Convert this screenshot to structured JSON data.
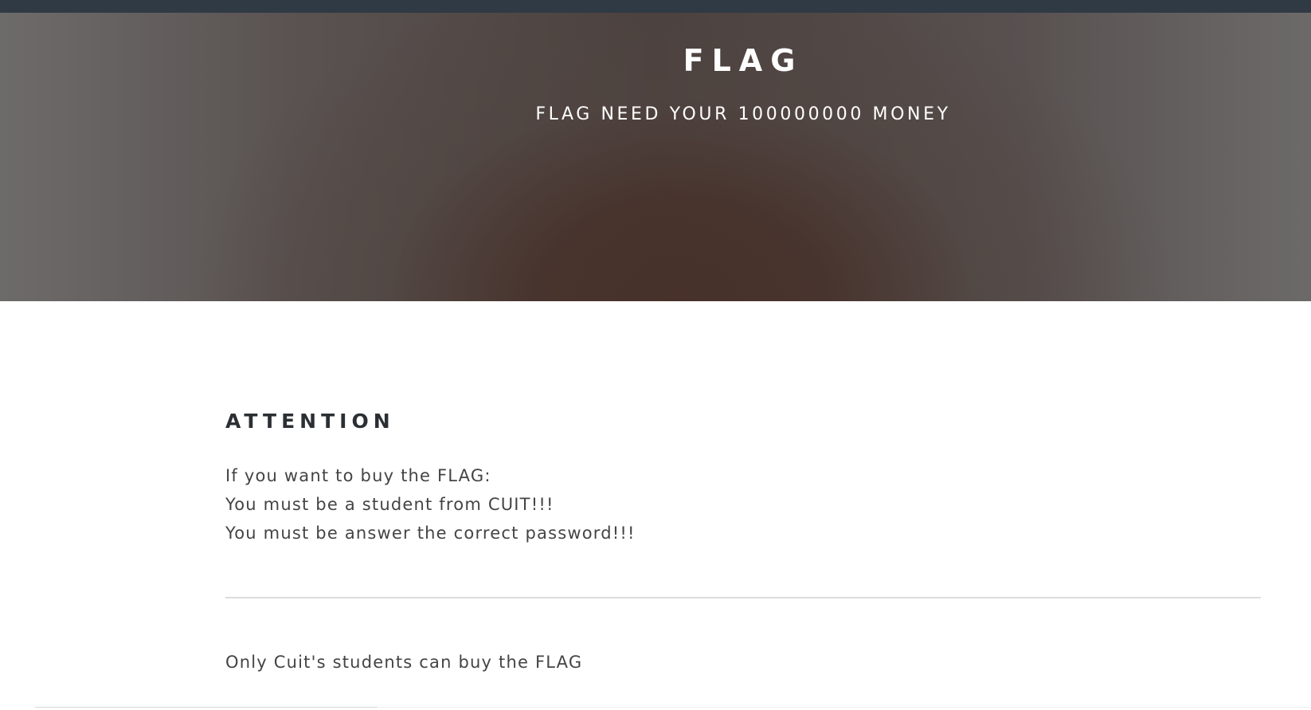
{
  "hero": {
    "title": "FLAG",
    "subtitle": "FLAG NEED YOUR 100000000 MONEY"
  },
  "main": {
    "heading": "ATTENTION",
    "lines": [
      "If you want to buy the FLAG:",
      "You must be a student from CUIT!!!",
      "You must be answer the correct password!!!"
    ],
    "note": "Only Cuit's students can buy the FLAG"
  },
  "colors": {
    "top_bar": "#2f3a45",
    "heading": "#2b2f33",
    "body_text": "#444444",
    "divider": "#dddddd"
  }
}
